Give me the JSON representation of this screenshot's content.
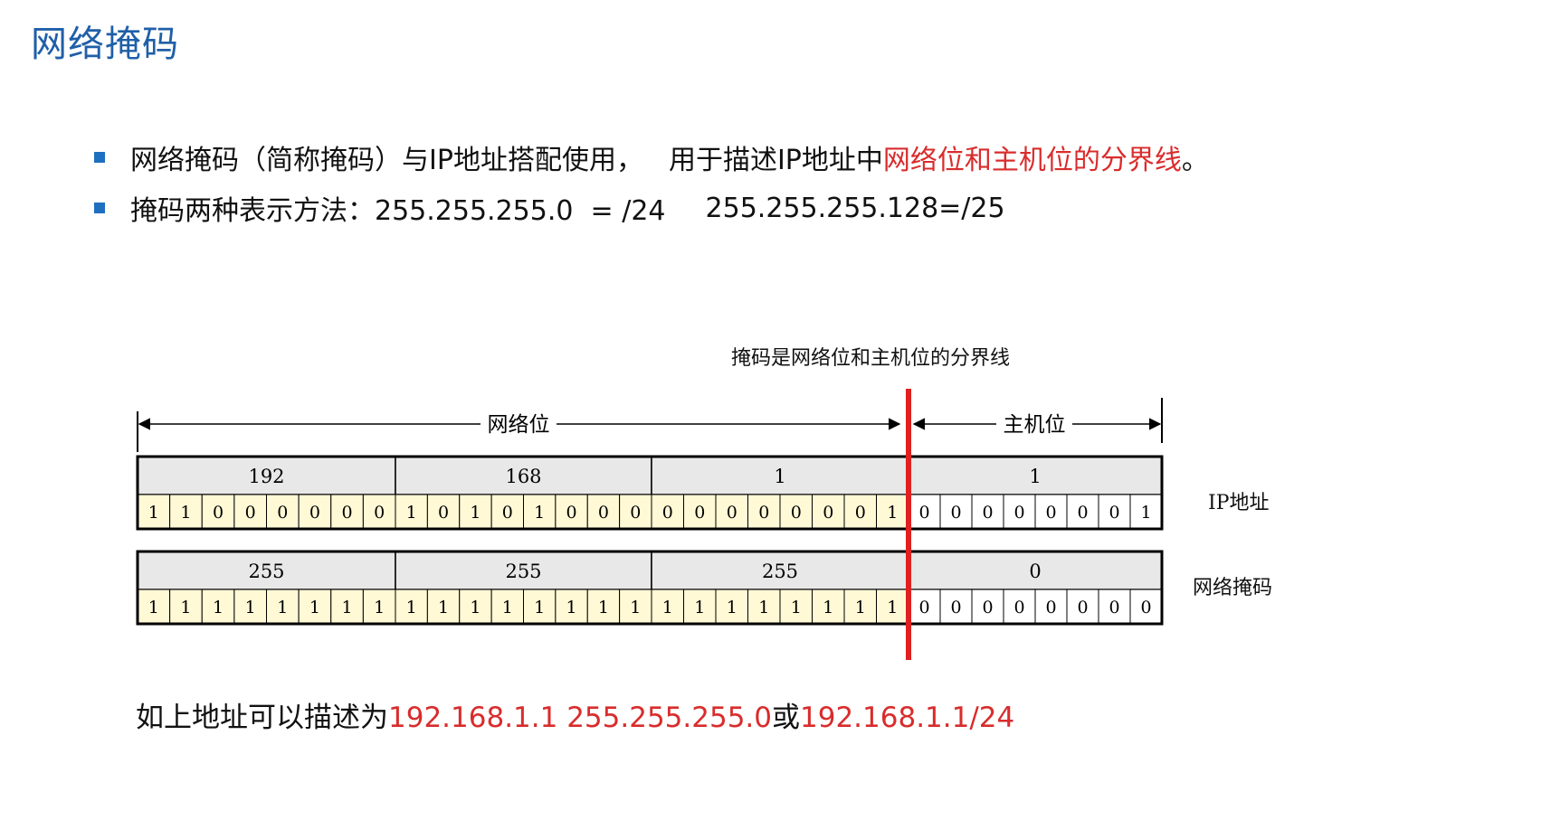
{
  "slide": {
    "title": "网络掩码",
    "bullets": [
      {
        "text_a": "网络掩码（简称掩码）与IP地址搭配使用，",
        "text_b": "用于描述IP地址中",
        "text_hl": "网络位和主机位的分界线",
        "text_end": "。"
      },
      {
        "text_a": "掩码两种表示方法：255.255.255.0  = /24",
        "text_b": "255.255.255.128=/25"
      }
    ],
    "bottom": {
      "prefix": "如上地址可以描述为",
      "notation1": "192.168.1.1 255.255.255.0",
      "connector": "或",
      "notation2": "192.168.1.1/24"
    }
  },
  "diagram": {
    "caption": "掩码是网络位和主机位的分界线",
    "network_label": "网络位",
    "host_label": "主机位",
    "ip_row_label": "IP地址",
    "mask_row_label": "网络掩码",
    "ip_octets": [
      "192",
      "168",
      "1",
      "1"
    ],
    "ip_bits": [
      "1",
      "1",
      "0",
      "0",
      "0",
      "0",
      "0",
      "0",
      "1",
      "0",
      "1",
      "0",
      "1",
      "0",
      "0",
      "0",
      "0",
      "0",
      "0",
      "0",
      "0",
      "0",
      "0",
      "1",
      "0",
      "0",
      "0",
      "0",
      "0",
      "0",
      "0",
      "1"
    ],
    "mask_octets": [
      "255",
      "255",
      "255",
      "0"
    ],
    "mask_bits": [
      "1",
      "1",
      "1",
      "1",
      "1",
      "1",
      "1",
      "1",
      "1",
      "1",
      "1",
      "1",
      "1",
      "1",
      "1",
      "1",
      "1",
      "1",
      "1",
      "1",
      "1",
      "1",
      "1",
      "1",
      "0",
      "0",
      "0",
      "0",
      "0",
      "0",
      "0",
      "0"
    ],
    "boundary_color": "#e02020"
  },
  "colors": {
    "title": "#1f5fa8",
    "highlight": "#d92c2c",
    "bullet": "#1f6fc0",
    "header_fill": "#e8e8e8",
    "bit_fill": "#fff9d6"
  }
}
